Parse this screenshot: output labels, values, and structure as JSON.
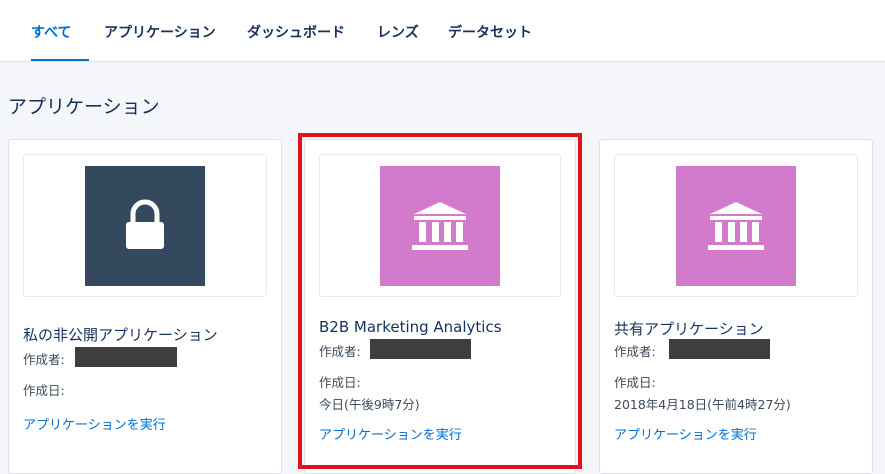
{
  "tabs": [
    {
      "label": "すべて"
    },
    {
      "label": "アプリケーション"
    },
    {
      "label": "ダッシュボード"
    },
    {
      "label": "レンズ"
    },
    {
      "label": "データセット"
    }
  ],
  "section": {
    "title": "アプリケーション"
  },
  "cards": [
    {
      "title": "私の非公開アプリケーション",
      "author_label": "作成者:",
      "created_label": "作成日:",
      "created_value": "",
      "run_label": "アプリケーションを実行",
      "icon": "lock-icon",
      "tile_color": "#34495e"
    },
    {
      "title": "B2B Marketing Analytics",
      "author_label": "作成者:",
      "created_label": "作成日:",
      "created_value": "今日(午後9時7分)",
      "run_label": "アプリケーションを実行",
      "icon": "bank-icon",
      "tile_color": "#d27acb"
    },
    {
      "title": "共有アプリケーション",
      "author_label": "作成者:",
      "created_label": "作成日:",
      "created_value": "2018年4月18日(午前4時27分)",
      "run_label": "アプリケーションを実行",
      "icon": "bank-icon",
      "tile_color": "#d27acb"
    }
  ],
  "colors": {
    "accent": "#0070d2",
    "highlight_border": "#e0141e"
  }
}
